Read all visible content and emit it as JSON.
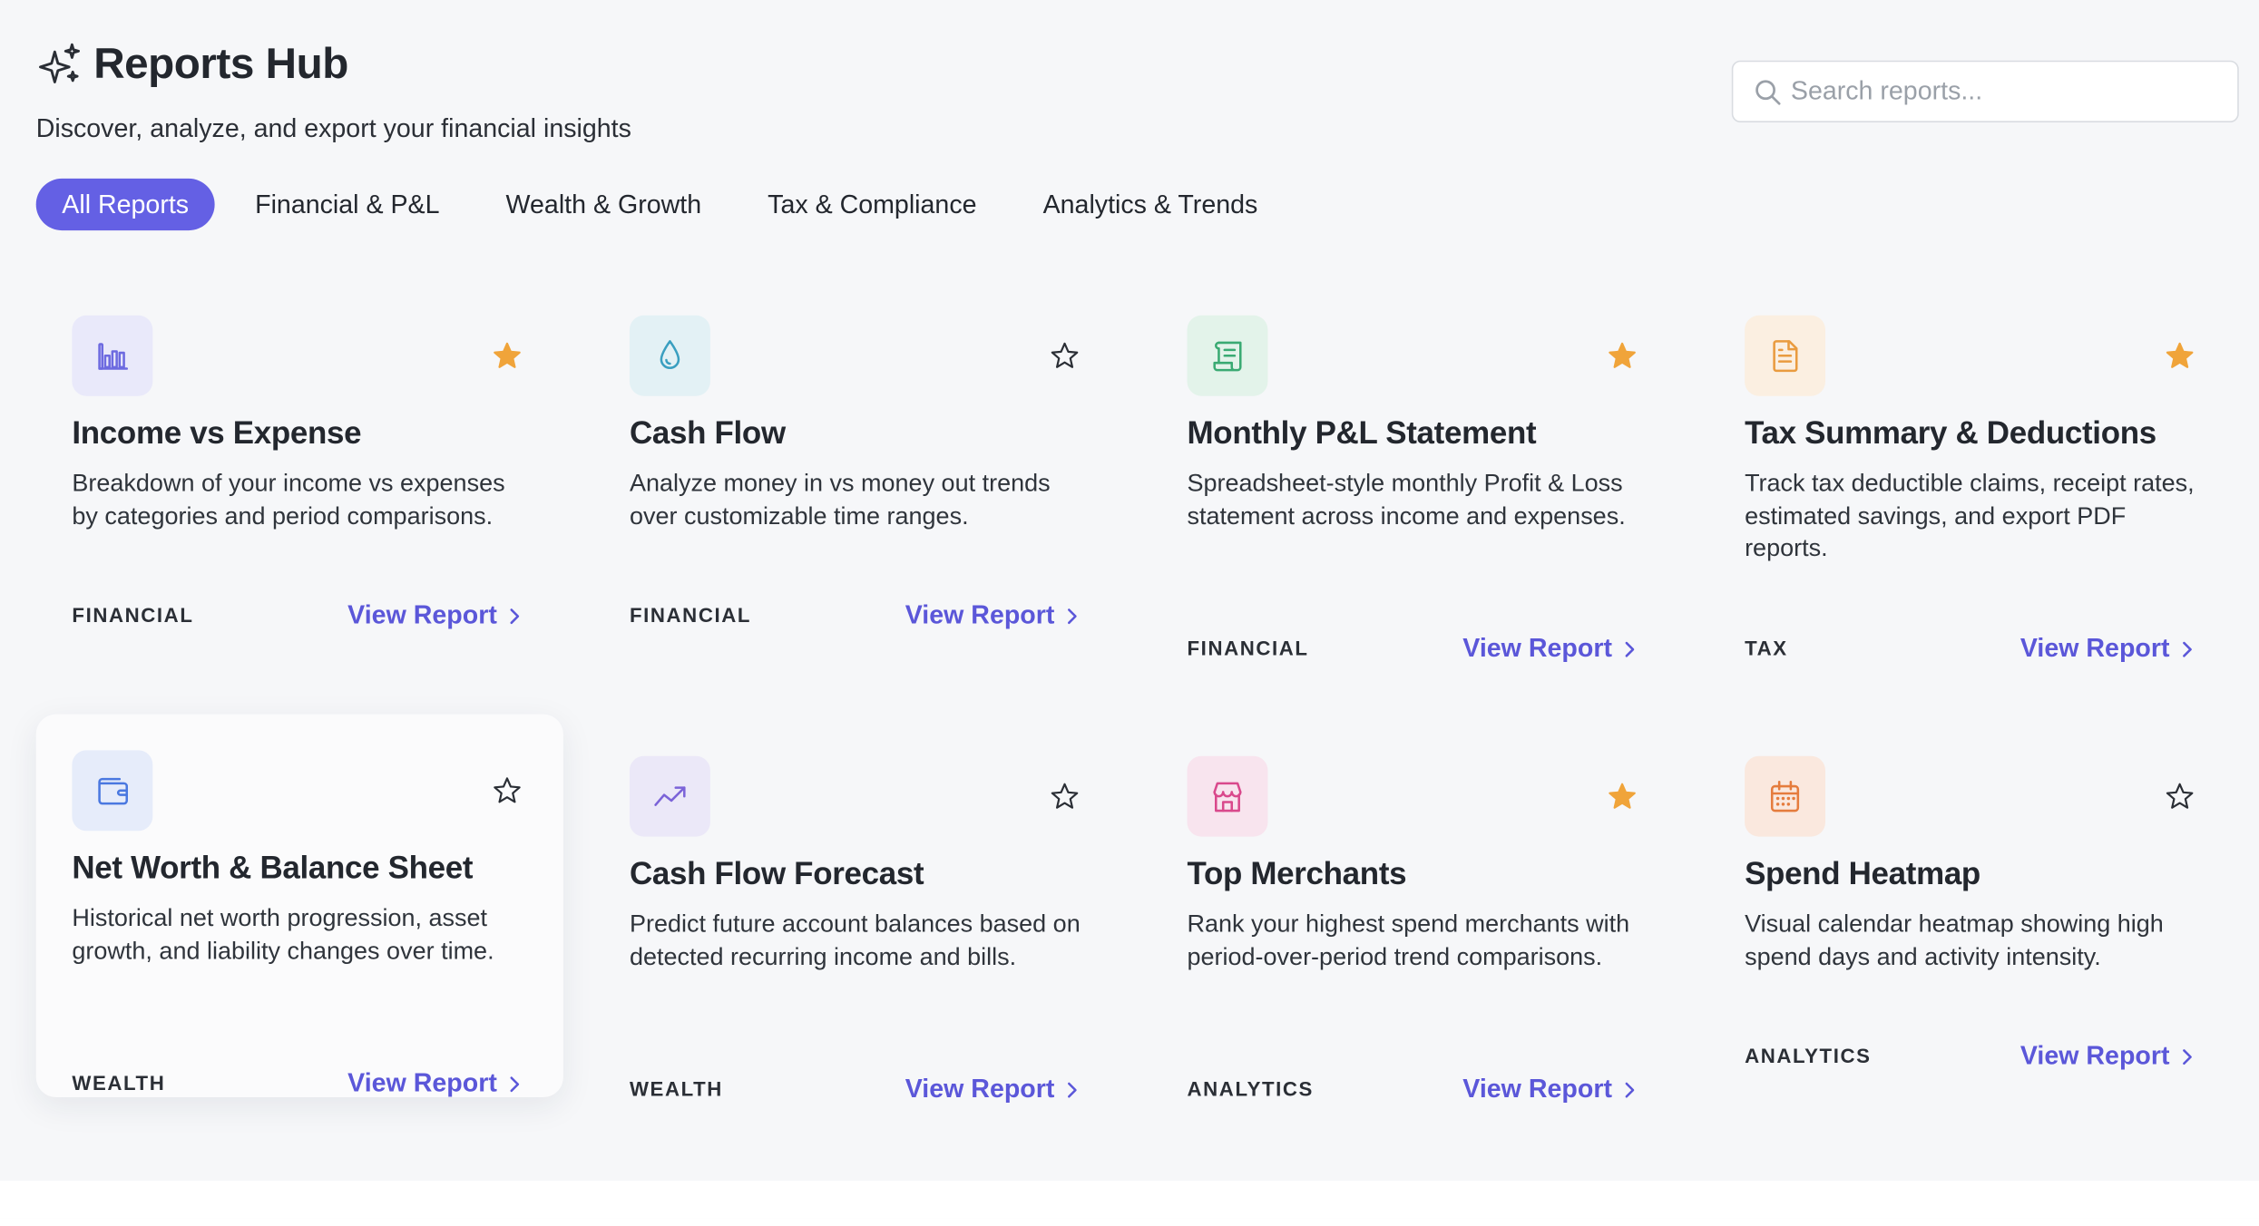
{
  "header": {
    "title": "Reports Hub",
    "subtitle": "Discover, analyze, and export your financial insights",
    "search_placeholder": "Search reports..."
  },
  "tabs": [
    {
      "label": "All Reports",
      "active": true
    },
    {
      "label": "Financial & P&L",
      "active": false
    },
    {
      "label": "Wealth & Growth",
      "active": false
    },
    {
      "label": "Tax & Compliance",
      "active": false
    },
    {
      "label": "Analytics & Trends",
      "active": false
    }
  ],
  "colors": {
    "accent": "#6460e4",
    "star_active": "#f0a43a",
    "link": "#5b57d9"
  },
  "cards": [
    {
      "title": "Income vs Expense",
      "description": "Breakdown of your income vs expenses by categories and period comparisons.",
      "category": "FINANCIAL",
      "link": "View Report",
      "starred": true,
      "icon": "bar-chart-icon",
      "icon_color": "#6d6ae0",
      "icon_bg": "#e9e9fa"
    },
    {
      "title": "Cash Flow",
      "description": "Analyze money in vs money out trends over customizable time ranges.",
      "category": "FINANCIAL",
      "link": "View Report",
      "starred": false,
      "icon": "droplet-icon",
      "icon_color": "#3a9fc0",
      "icon_bg": "#e3f1f5"
    },
    {
      "title": "Monthly P&L Statement",
      "description": "Spreadsheet-style monthly Profit & Loss statement across income and expenses.",
      "category": "FINANCIAL",
      "link": "View Report",
      "starred": true,
      "icon": "receipt-icon",
      "icon_color": "#3aaa73",
      "icon_bg": "#e3f3ea"
    },
    {
      "title": "Tax Summary & Deductions",
      "description": "Track tax deductible claims, receipt rates, estimated savings, and export PDF reports.",
      "category": "TAX",
      "link": "View Report",
      "starred": true,
      "icon": "document-icon",
      "icon_color": "#e99b3f",
      "icon_bg": "#fbefe1"
    },
    {
      "title": "Net Worth & Balance Sheet",
      "description": "Historical net worth progression, asset growth, and liability changes over time.",
      "category": "WEALTH",
      "link": "View Report",
      "starred": false,
      "icon": "wallet-icon",
      "icon_color": "#4a78e0",
      "icon_bg": "#e6ecfa"
    },
    {
      "title": "Cash Flow Forecast",
      "description": "Predict future account balances based on detected recurring income and bills.",
      "category": "WEALTH",
      "link": "View Report",
      "starred": false,
      "icon": "trending-up-icon",
      "icon_color": "#7b63d8",
      "icon_bg": "#ebe8f8"
    },
    {
      "title": "Top Merchants",
      "description": "Rank your highest spend merchants with period-over-period trend comparisons.",
      "category": "ANALYTICS",
      "link": "View Report",
      "starred": true,
      "icon": "store-icon",
      "icon_color": "#d9498c",
      "icon_bg": "#f8e4ee"
    },
    {
      "title": "Spend Heatmap",
      "description": "Visual calendar heatmap showing high spend days and activity intensity.",
      "category": "ANALYTICS",
      "link": "View Report",
      "starred": false,
      "icon": "calendar-icon",
      "icon_color": "#e57c3d",
      "icon_bg": "#fae8de"
    }
  ]
}
